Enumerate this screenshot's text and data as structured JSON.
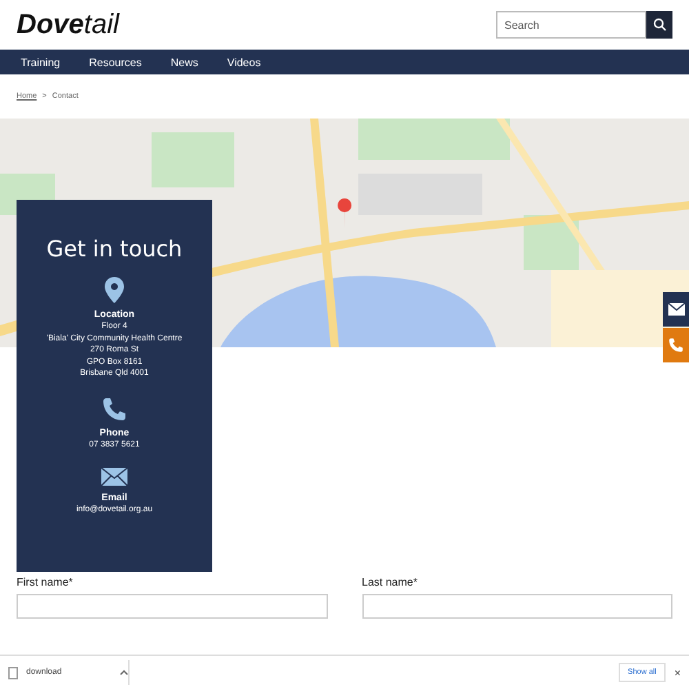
{
  "logo": {
    "bold": "Dove",
    "light": "tail"
  },
  "search": {
    "placeholder": "Search"
  },
  "nav": [
    "Training",
    "Resources",
    "News",
    "Videos"
  ],
  "breadcrumb": {
    "home": "Home",
    "separator": ">",
    "current": "Contact"
  },
  "map": {
    "kind": "picture"
  },
  "contact": {
    "title": "Get in touch",
    "sections": [
      {
        "kind": "location",
        "heading": "Location",
        "lines": [
          "Floor 4",
          "'Biala' City Community Health Centre",
          "270 Roma St",
          "GPO Box 8161",
          "Brisbane Qld 4001"
        ]
      },
      {
        "kind": "phone",
        "heading": "Phone",
        "lines": [
          "07 3837 5621"
        ]
      },
      {
        "kind": "email",
        "heading": "Email",
        "lines": [
          "info@dovetail.org.au"
        ]
      }
    ]
  },
  "side_buttons": [
    {
      "kind": "email"
    },
    {
      "kind": "phone"
    }
  ],
  "form": {
    "fields": [
      {
        "label": "First name*"
      },
      {
        "label": "Last name*"
      }
    ]
  },
  "download_bar": {
    "file": "download",
    "show_all": "Show all",
    "close": "×"
  }
}
